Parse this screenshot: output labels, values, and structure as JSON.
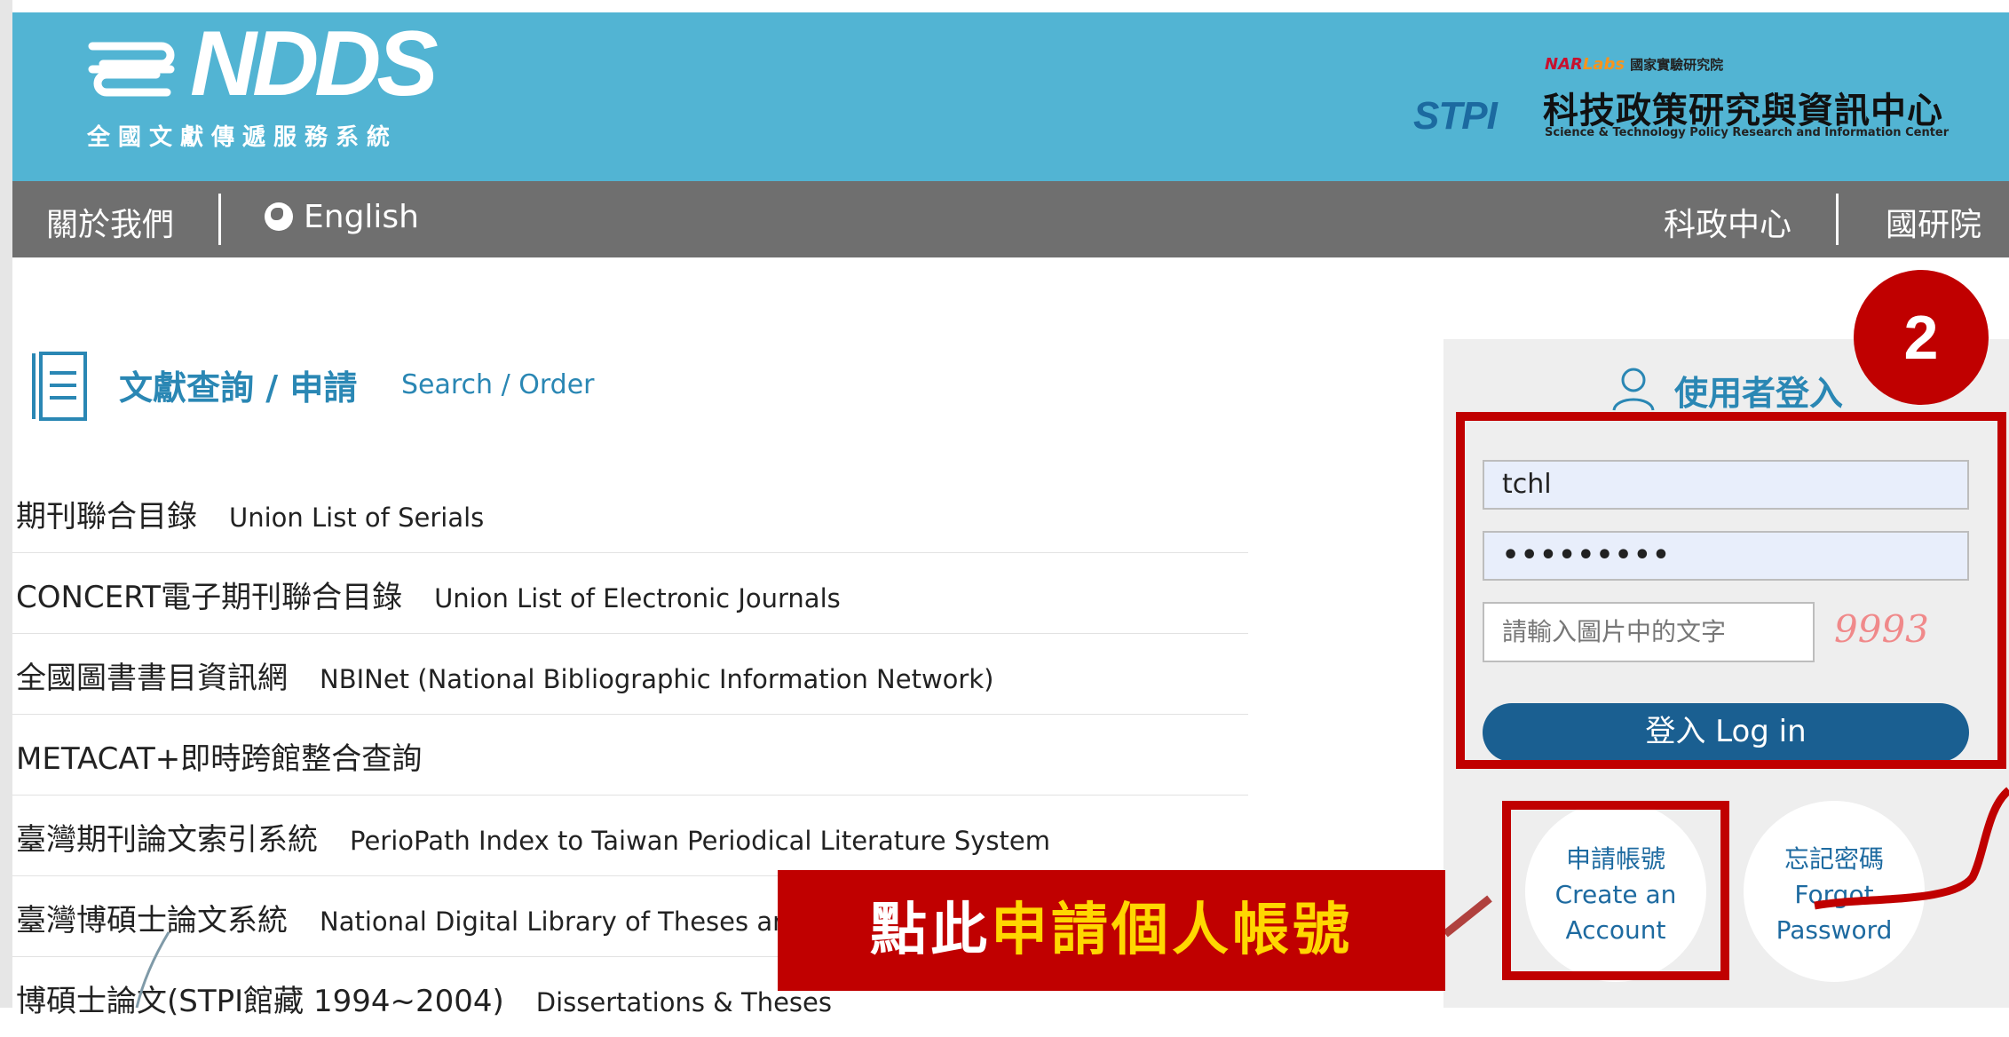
{
  "header": {
    "logo_title": "NDDS",
    "logo_subtitle": "全國文獻傳遞服務系統",
    "partner": {
      "stpi_logo": "STPI",
      "narlabs_nar": "NAR",
      "narlabs_labs": "Labs",
      "narlabs_institute": "國家實驗研究院",
      "name_cn": "科技政策研究與資訊中心",
      "name_en": "Science & Technology Policy Research and Information Center"
    }
  },
  "nav": {
    "about": "關於我們",
    "english": "English",
    "stpi_center": "科政中心",
    "narlabs": "國研院"
  },
  "search": {
    "title": "文獻查詢 / 申請",
    "subtitle": "Search / Order",
    "items": [
      {
        "cn": "期刊聯合目錄",
        "en": "Union List of Serials"
      },
      {
        "cn": "CONCERT電子期刊聯合目錄",
        "en": "Union List of Electronic Journals"
      },
      {
        "cn": "全國圖書書目資訊網",
        "en": "NBINet (National Bibliographic Information Network)"
      },
      {
        "cn": "METACAT+即時跨館整合查詢",
        "en": ""
      },
      {
        "cn": "臺灣期刊論文索引系統",
        "en": "PerioPath Index to Taiwan Periodical Literature System"
      },
      {
        "cn": "臺灣博碩士論文系統",
        "en": "National Digital Library of Theses and Dissertations"
      },
      {
        "cn": "博碩士論文(STPI館藏 1994~2004)",
        "en": "Dissertations & Theses"
      }
    ]
  },
  "login": {
    "title": "使用者登入",
    "username_value": "tchl",
    "password_value": "•••••••••",
    "captcha_placeholder": "請輸入圖片中的文字",
    "captcha_code": "9993",
    "login_button": "登入 Log in",
    "create_cn": "申請帳號",
    "create_en_1": "Create an",
    "create_en_2": "Account",
    "forgot_cn": "忘記密碼",
    "forgot_en_1": "Forgot",
    "forgot_en_2": "Password"
  },
  "annotation": {
    "step_number": "2",
    "callout_prefix": "點此",
    "callout_highlight": "申請個人帳號"
  },
  "colors": {
    "header_bg": "#52b4d3",
    "nav_bg": "#6f6f6f",
    "accent_blue": "#2a87b4",
    "login_button": "#1a5f91",
    "annotation_red": "#c00000",
    "highlight_yellow": "#ffd700"
  }
}
